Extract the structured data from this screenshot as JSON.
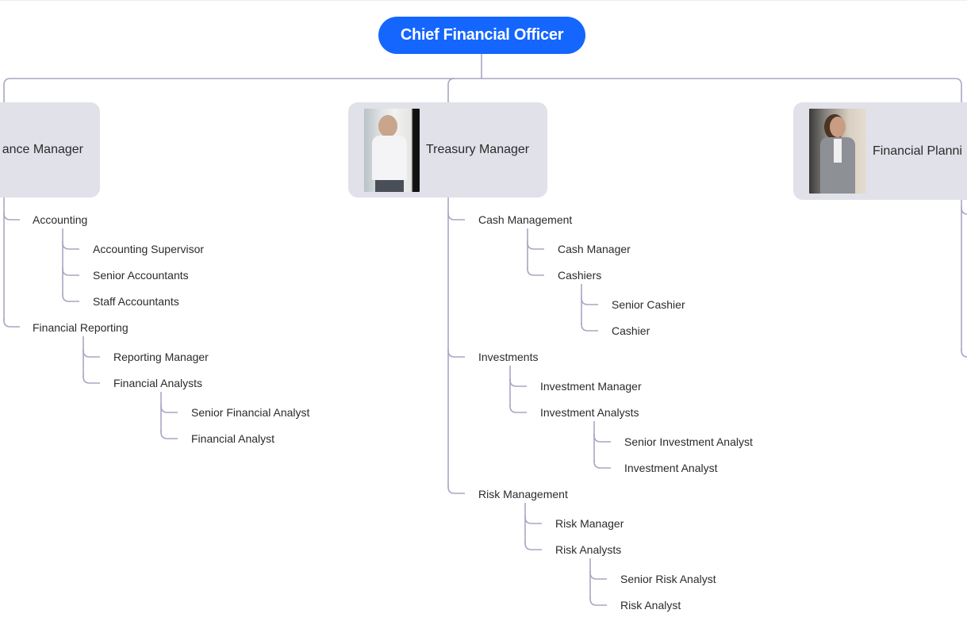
{
  "root": {
    "label": "Chief Financial Officer",
    "color": "#1466ff"
  },
  "line_color": "#a9a6c4",
  "managers": [
    {
      "label": "Finance Manager",
      "visible_label": "ance Manager"
    },
    {
      "label": "Treasury Manager",
      "photo": "man-portrait-photo"
    },
    {
      "label": "Financial Planning",
      "visible_label": "Financial Planni",
      "photo": "woman-portrait-photo"
    }
  ],
  "finance": {
    "accounting": {
      "label": "Accounting",
      "children": [
        "Accounting Supervisor",
        "Senior Accountants",
        "Staff Accountants"
      ]
    },
    "reporting": {
      "label": "Financial Reporting",
      "children": [
        "Reporting Manager",
        "Financial Analysts"
      ],
      "analysts": [
        "Senior Financial Analyst",
        "Financial Analyst"
      ]
    }
  },
  "treasury": {
    "cash": {
      "label": "Cash Management",
      "children": [
        "Cash Manager",
        "Cashiers"
      ],
      "cashiers": [
        "Senior Cashier",
        "Cashier"
      ]
    },
    "investments": {
      "label": "Investments",
      "children": [
        "Investment Manager",
        "Investment Analysts"
      ],
      "analysts": [
        "Senior Investment Analyst",
        "Investment Analyst"
      ]
    },
    "risk": {
      "label": "Risk Management",
      "children": [
        "Risk Manager",
        "Risk Analysts"
      ],
      "analysts": [
        "Senior Risk Analyst",
        "Risk Analyst"
      ]
    }
  }
}
